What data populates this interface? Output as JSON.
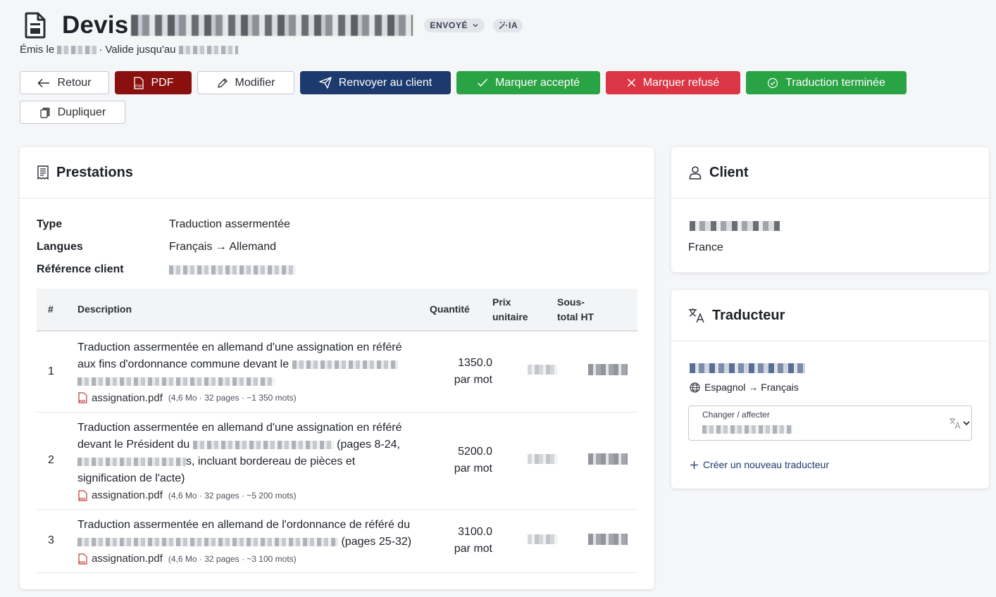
{
  "header": {
    "title_prefix": "Devis ",
    "status_badge": "ENVOYÉ",
    "ia_badge": "IA",
    "issued_label": "Émis le",
    "valid_label": "· Valide jusqu'au"
  },
  "actions": {
    "back": "Retour",
    "pdf": "PDF",
    "edit": "Modifier",
    "resend": "Renvoyer au client",
    "accept": "Marquer accepté",
    "refuse": "Marquer refusé",
    "translation_done": "Traduction terminée",
    "duplicate": "Dupliquer"
  },
  "prestations": {
    "title": "Prestations",
    "fields": [
      {
        "key": "Type",
        "value": "Traduction assermentée"
      },
      {
        "key": "Langues",
        "value": "Français → Allemand"
      },
      {
        "key": "Référence client",
        "value": ""
      }
    ],
    "columns": {
      "num": "#",
      "description": "Description",
      "quantity": "Quantité",
      "unit_price_1": "Prix",
      "unit_price_2": "unitaire",
      "subtotal_1": "Sous-",
      "subtotal_2": "total HT"
    },
    "rows": [
      {
        "num": "1",
        "desc_line1": "Traduction assermentée en allemand d'une assignation en référé",
        "desc_line2": "aux fins d'ordonnance commune devant le",
        "file": "assignation.pdf",
        "file_meta": "(4,6 Mo · 32 pages · ~1 350 mots)",
        "quantity": "1350.0",
        "unit": "par mot"
      },
      {
        "num": "2",
        "desc_line1": "Traduction assermentée en allemand d'une assignation en référé",
        "desc_line2a": "devant le Président du",
        "desc_line2b": "(pages 8-24,",
        "desc_line3": "s, incluant bordereau de pièces et",
        "desc_line4": "signification de l'acte)",
        "file": "assignation.pdf",
        "file_meta": "(4,6 Mo · 32 pages · ~5 200 mots)",
        "quantity": "5200.0",
        "unit": "par mot"
      },
      {
        "num": "3",
        "desc_line1": "Traduction assermentée en allemand de l'ordonnance de référé du",
        "desc_line2": "(pages 25-32)",
        "file": "assignation.pdf",
        "file_meta": "(4,6 Mo · 32 pages · ~3 100 mots)",
        "quantity": "3100.0",
        "unit": "par mot"
      }
    ]
  },
  "client": {
    "title": "Client",
    "country": "France"
  },
  "translator": {
    "title": "Traducteur",
    "languages": "Espagnol → Français",
    "select_label": "Changer / affecter",
    "create_link": "Créer un nouveau traducteur"
  },
  "colors": {
    "navy": "#1c3a6e",
    "pdf_red": "#8a1010",
    "green": "#2aa344",
    "red": "#dc3545"
  }
}
